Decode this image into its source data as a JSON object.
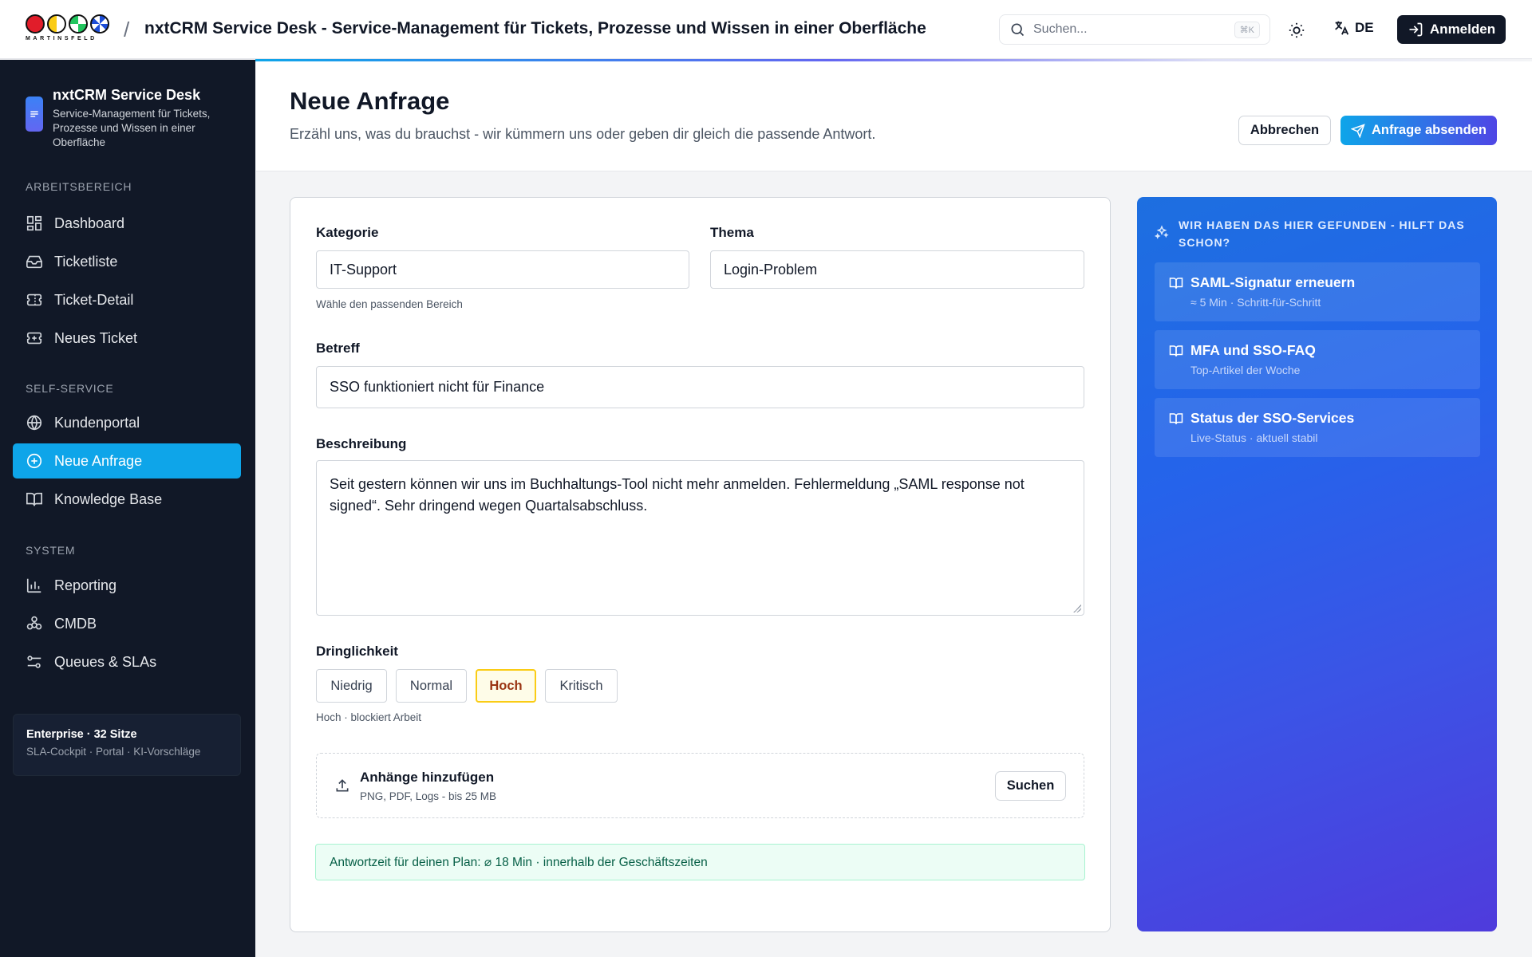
{
  "header": {
    "logo_word": "MARTINSFELD",
    "breadcrumb_sep": "/",
    "app_title": "nxtCRM Service Desk - Service-Management für Tickets, Prozesse und Wissen in einer Oberfläche",
    "search_placeholder": "Suchen...",
    "search_shortcut": "⌘K",
    "language": "DE",
    "login_label": "Anmelden"
  },
  "sidebar": {
    "brand_title": "nxtCRM Service Desk",
    "brand_sub": "Service-Management für Tickets, Prozesse und Wissen in einer Oberfläche",
    "sections": [
      {
        "label": "ARBEITSBEREICH",
        "items": [
          {
            "label": "Dashboard",
            "icon": "dashboard-icon"
          },
          {
            "label": "Ticketliste",
            "icon": "inbox-icon"
          },
          {
            "label": "Ticket-Detail",
            "icon": "ticket-icon"
          },
          {
            "label": "Neues Ticket",
            "icon": "ticket-plus-icon"
          }
        ]
      },
      {
        "label": "SELF-SERVICE",
        "items": [
          {
            "label": "Kundenportal",
            "icon": "globe-icon"
          },
          {
            "label": "Neue Anfrage",
            "icon": "plus-circle-icon",
            "active": true
          },
          {
            "label": "Knowledge Base",
            "icon": "book-icon"
          }
        ]
      },
      {
        "label": "SYSTEM",
        "items": [
          {
            "label": "Reporting",
            "icon": "bar-chart-icon"
          },
          {
            "label": "CMDB",
            "icon": "cmdb-icon"
          },
          {
            "label": "Queues & SLAs",
            "icon": "sliders-icon"
          }
        ]
      }
    ],
    "plan": {
      "title": "Enterprise · 32 Sitze",
      "sub": "SLA-Cockpit · Portal · KI-Vorschläge"
    }
  },
  "page": {
    "title": "Neue Anfrage",
    "subtitle": "Erzähl uns, was du brauchst - wir kümmern uns oder geben dir gleich die passende Antwort.",
    "cancel_label": "Abbrechen",
    "submit_label": "Anfrage absenden"
  },
  "form": {
    "category_label": "Kategorie",
    "category_value": "IT-Support",
    "category_hint": "Wähle den passenden Bereich",
    "topic_label": "Thema",
    "topic_value": "Login-Problem",
    "subject_label": "Betreff",
    "subject_value": "SSO funktioniert nicht für Finance",
    "description_label": "Beschreibung",
    "description_value": "Seit gestern können wir uns im Buchhaltungs-Tool nicht mehr anmelden. Fehlermeldung „SAML response not signed“. Sehr dringend wegen Quartalsabschluss.",
    "urgency_label": "Dringlichkeit",
    "urgency_options": [
      "Niedrig",
      "Normal",
      "Hoch",
      "Kritisch"
    ],
    "urgency_selected": "Hoch",
    "urgency_hint": "Hoch · blockiert Arbeit",
    "attachments_title": "Anhänge hinzufügen",
    "attachments_sub": "PNG, PDF, Logs - bis 25 MB",
    "attachments_button": "Suchen",
    "response_time": "Antwortzeit für deinen Plan: ⌀ 18 Min · innerhalb der Geschäftszeiten"
  },
  "suggestions": {
    "heading": "WIR HABEN DAS HIER GEFUNDEN - HILFT DAS SCHON?",
    "items": [
      {
        "title": "SAML-Signatur erneuern",
        "sub": "≈ 5 Min · Schritt-für-Schritt"
      },
      {
        "title": "MFA und SSO-FAQ",
        "sub": "Top-Artikel der Woche"
      },
      {
        "title": "Status der SSO-Services",
        "sub": "Live-Status · aktuell stabil"
      }
    ]
  },
  "colors": {
    "sidebar_bg": "#111827",
    "active_nav": "#0ea5e9",
    "accent_blue": "#2563eb",
    "accent_indigo": "#4f46e5",
    "urgency_selected_border": "#facc15",
    "success_bg": "#ecfdf5"
  }
}
